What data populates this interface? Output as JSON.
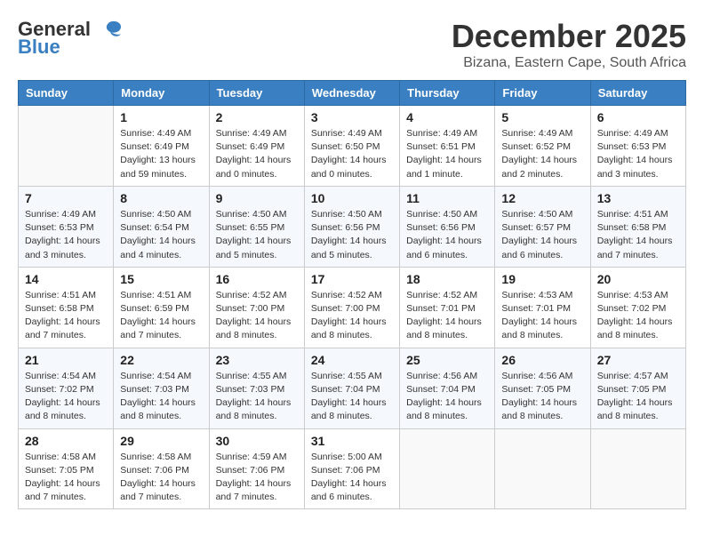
{
  "header": {
    "logo_general": "General",
    "logo_blue": "Blue",
    "month_title": "December 2025",
    "location": "Bizana, Eastern Cape, South Africa"
  },
  "days_of_week": [
    "Sunday",
    "Monday",
    "Tuesday",
    "Wednesday",
    "Thursday",
    "Friday",
    "Saturday"
  ],
  "weeks": [
    [
      {
        "day": "",
        "sunrise": "",
        "sunset": "",
        "daylight": ""
      },
      {
        "day": "1",
        "sunrise": "Sunrise: 4:49 AM",
        "sunset": "Sunset: 6:49 PM",
        "daylight": "Daylight: 13 hours and 59 minutes."
      },
      {
        "day": "2",
        "sunrise": "Sunrise: 4:49 AM",
        "sunset": "Sunset: 6:49 PM",
        "daylight": "Daylight: 14 hours and 0 minutes."
      },
      {
        "day": "3",
        "sunrise": "Sunrise: 4:49 AM",
        "sunset": "Sunset: 6:50 PM",
        "daylight": "Daylight: 14 hours and 0 minutes."
      },
      {
        "day": "4",
        "sunrise": "Sunrise: 4:49 AM",
        "sunset": "Sunset: 6:51 PM",
        "daylight": "Daylight: 14 hours and 1 minute."
      },
      {
        "day": "5",
        "sunrise": "Sunrise: 4:49 AM",
        "sunset": "Sunset: 6:52 PM",
        "daylight": "Daylight: 14 hours and 2 minutes."
      },
      {
        "day": "6",
        "sunrise": "Sunrise: 4:49 AM",
        "sunset": "Sunset: 6:53 PM",
        "daylight": "Daylight: 14 hours and 3 minutes."
      }
    ],
    [
      {
        "day": "7",
        "sunrise": "Sunrise: 4:49 AM",
        "sunset": "Sunset: 6:53 PM",
        "daylight": "Daylight: 14 hours and 3 minutes."
      },
      {
        "day": "8",
        "sunrise": "Sunrise: 4:50 AM",
        "sunset": "Sunset: 6:54 PM",
        "daylight": "Daylight: 14 hours and 4 minutes."
      },
      {
        "day": "9",
        "sunrise": "Sunrise: 4:50 AM",
        "sunset": "Sunset: 6:55 PM",
        "daylight": "Daylight: 14 hours and 5 minutes."
      },
      {
        "day": "10",
        "sunrise": "Sunrise: 4:50 AM",
        "sunset": "Sunset: 6:56 PM",
        "daylight": "Daylight: 14 hours and 5 minutes."
      },
      {
        "day": "11",
        "sunrise": "Sunrise: 4:50 AM",
        "sunset": "Sunset: 6:56 PM",
        "daylight": "Daylight: 14 hours and 6 minutes."
      },
      {
        "day": "12",
        "sunrise": "Sunrise: 4:50 AM",
        "sunset": "Sunset: 6:57 PM",
        "daylight": "Daylight: 14 hours and 6 minutes."
      },
      {
        "day": "13",
        "sunrise": "Sunrise: 4:51 AM",
        "sunset": "Sunset: 6:58 PM",
        "daylight": "Daylight: 14 hours and 7 minutes."
      }
    ],
    [
      {
        "day": "14",
        "sunrise": "Sunrise: 4:51 AM",
        "sunset": "Sunset: 6:58 PM",
        "daylight": "Daylight: 14 hours and 7 minutes."
      },
      {
        "day": "15",
        "sunrise": "Sunrise: 4:51 AM",
        "sunset": "Sunset: 6:59 PM",
        "daylight": "Daylight: 14 hours and 7 minutes."
      },
      {
        "day": "16",
        "sunrise": "Sunrise: 4:52 AM",
        "sunset": "Sunset: 7:00 PM",
        "daylight": "Daylight: 14 hours and 8 minutes."
      },
      {
        "day": "17",
        "sunrise": "Sunrise: 4:52 AM",
        "sunset": "Sunset: 7:00 PM",
        "daylight": "Daylight: 14 hours and 8 minutes."
      },
      {
        "day": "18",
        "sunrise": "Sunrise: 4:52 AM",
        "sunset": "Sunset: 7:01 PM",
        "daylight": "Daylight: 14 hours and 8 minutes."
      },
      {
        "day": "19",
        "sunrise": "Sunrise: 4:53 AM",
        "sunset": "Sunset: 7:01 PM",
        "daylight": "Daylight: 14 hours and 8 minutes."
      },
      {
        "day": "20",
        "sunrise": "Sunrise: 4:53 AM",
        "sunset": "Sunset: 7:02 PM",
        "daylight": "Daylight: 14 hours and 8 minutes."
      }
    ],
    [
      {
        "day": "21",
        "sunrise": "Sunrise: 4:54 AM",
        "sunset": "Sunset: 7:02 PM",
        "daylight": "Daylight: 14 hours and 8 minutes."
      },
      {
        "day": "22",
        "sunrise": "Sunrise: 4:54 AM",
        "sunset": "Sunset: 7:03 PM",
        "daylight": "Daylight: 14 hours and 8 minutes."
      },
      {
        "day": "23",
        "sunrise": "Sunrise: 4:55 AM",
        "sunset": "Sunset: 7:03 PM",
        "daylight": "Daylight: 14 hours and 8 minutes."
      },
      {
        "day": "24",
        "sunrise": "Sunrise: 4:55 AM",
        "sunset": "Sunset: 7:04 PM",
        "daylight": "Daylight: 14 hours and 8 minutes."
      },
      {
        "day": "25",
        "sunrise": "Sunrise: 4:56 AM",
        "sunset": "Sunset: 7:04 PM",
        "daylight": "Daylight: 14 hours and 8 minutes."
      },
      {
        "day": "26",
        "sunrise": "Sunrise: 4:56 AM",
        "sunset": "Sunset: 7:05 PM",
        "daylight": "Daylight: 14 hours and 8 minutes."
      },
      {
        "day": "27",
        "sunrise": "Sunrise: 4:57 AM",
        "sunset": "Sunset: 7:05 PM",
        "daylight": "Daylight: 14 hours and 8 minutes."
      }
    ],
    [
      {
        "day": "28",
        "sunrise": "Sunrise: 4:58 AM",
        "sunset": "Sunset: 7:05 PM",
        "daylight": "Daylight: 14 hours and 7 minutes."
      },
      {
        "day": "29",
        "sunrise": "Sunrise: 4:58 AM",
        "sunset": "Sunset: 7:06 PM",
        "daylight": "Daylight: 14 hours and 7 minutes."
      },
      {
        "day": "30",
        "sunrise": "Sunrise: 4:59 AM",
        "sunset": "Sunset: 7:06 PM",
        "daylight": "Daylight: 14 hours and 7 minutes."
      },
      {
        "day": "31",
        "sunrise": "Sunrise: 5:00 AM",
        "sunset": "Sunset: 7:06 PM",
        "daylight": "Daylight: 14 hours and 6 minutes."
      },
      {
        "day": "",
        "sunrise": "",
        "sunset": "",
        "daylight": ""
      },
      {
        "day": "",
        "sunrise": "",
        "sunset": "",
        "daylight": ""
      },
      {
        "day": "",
        "sunrise": "",
        "sunset": "",
        "daylight": ""
      }
    ]
  ]
}
